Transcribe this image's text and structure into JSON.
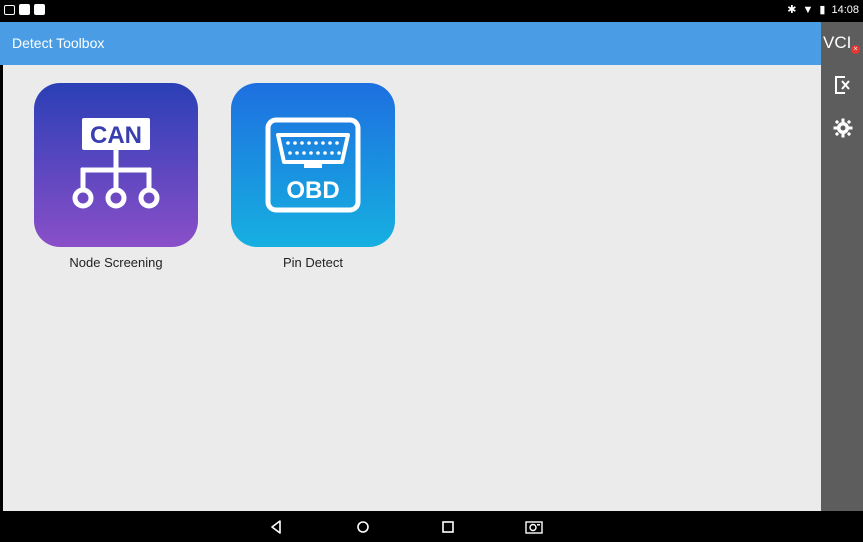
{
  "status_bar": {
    "time": "14:08",
    "icons": [
      "notification-icon",
      "notification-icon",
      "notification-icon",
      "bluetooth-icon",
      "wifi-icon",
      "battery-icon"
    ]
  },
  "app_bar": {
    "title": "Detect Toolbox"
  },
  "side_rail": {
    "vci_label": "VCI",
    "vci_badge": "×",
    "items": [
      {
        "icon": "exit-icon"
      },
      {
        "icon": "gear-icon"
      }
    ]
  },
  "tiles": [
    {
      "label": "Node Screening",
      "icon_text": "CAN",
      "icon": "can-bus-icon",
      "colors": [
        "#2a3fb6",
        "#8a4fc8"
      ]
    },
    {
      "label": "Pin Detect",
      "icon_text": "OBD",
      "icon": "obd-connector-icon",
      "colors": [
        "#1e6fe0",
        "#16b0e0"
      ]
    }
  ],
  "nav_bar": {
    "buttons": [
      "back-icon",
      "home-icon",
      "recents-icon",
      "screenshot-icon"
    ]
  }
}
